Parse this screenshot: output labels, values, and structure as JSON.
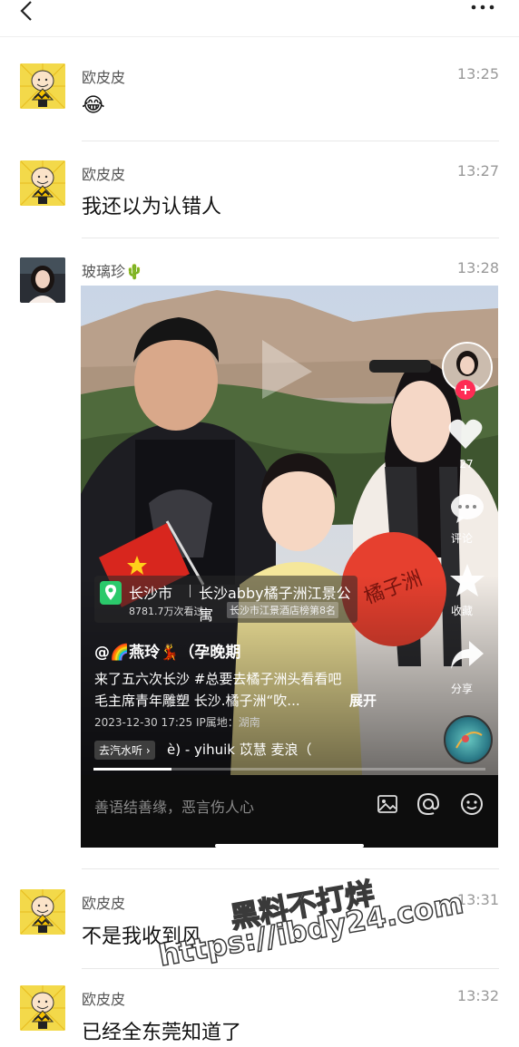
{
  "messages": [
    {
      "name": "欧皮皮",
      "time": "13:25",
      "text": "😂"
    },
    {
      "name": "欧皮皮",
      "time": "13:27",
      "text": "我还以为认错人"
    },
    {
      "name": "玻璃珍🌵",
      "time": "13:28"
    },
    {
      "name": "欧皮皮",
      "time": "13:31",
      "text": "不是我收到风"
    },
    {
      "name": "欧皮皮",
      "time": "13:32",
      "text": "已经全东莞知道了"
    }
  ],
  "video": {
    "location_city": "长沙市",
    "location_name": "长沙abby橘子洲江景公寓",
    "views": "8781.7万次看过",
    "rank_badge": "长沙市江景酒店榜第8名",
    "author": "@🌈燕玲💃（孕晚期",
    "caption_line1": "来了五六次长沙 #总要去橘子洲头看看吧",
    "caption_line2": "毛主席青年雕塑 长沙.橘子洲“吹...",
    "expand": "展开",
    "meta": "2023-12-30 17:25  IP属地：湖南",
    "music_tag": "去汽水听 ›",
    "music_text": "è) - yihuik 苡慧    麦浪（",
    "like_count": "27",
    "comment_label": "评论",
    "fav_label": "收藏",
    "share_label": "分享",
    "comment_placeholder": "善语结善缘，恶言伤人心",
    "fan_text": "橘子洲"
  },
  "watermark": {
    "line1": "黑料不打烊",
    "line2": "https://ibdy24.com"
  },
  "colors": {
    "accent_red": "#fe2c55",
    "location_green": "#2bc96b"
  }
}
